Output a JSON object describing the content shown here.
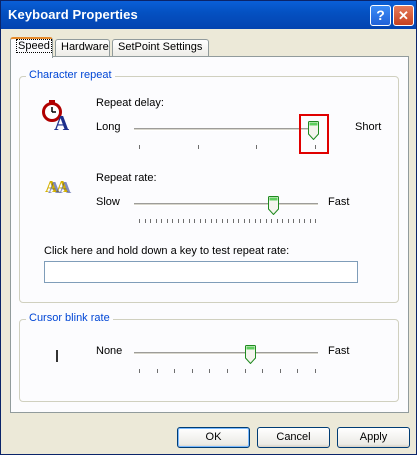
{
  "window": {
    "title": "Keyboard Properties"
  },
  "titlebar": {
    "help_label": "?",
    "close_label": "✕"
  },
  "tabs": [
    {
      "label": "Speed",
      "active": true
    },
    {
      "label": "Hardware",
      "active": false
    },
    {
      "label": "SetPoint Settings",
      "active": false
    }
  ],
  "character_repeat": {
    "group_title": "Character repeat",
    "repeat_delay": {
      "label": "Repeat delay:",
      "min_label": "Long",
      "max_label": "Short",
      "value": 4,
      "max": 4
    },
    "repeat_rate": {
      "label": "Repeat rate:",
      "min_label": "Slow",
      "max_label": "Fast",
      "value": 27,
      "max": 32
    },
    "test_label": "Click here and hold down a key to test repeat rate:",
    "test_value": ""
  },
  "cursor_blink": {
    "group_title": "Cursor blink rate",
    "min_label": "None",
    "max_label": "Fast",
    "value": 0.58
  },
  "buttons": {
    "ok": "OK",
    "cancel": "Cancel",
    "apply": "Apply"
  },
  "colors": {
    "titlebar": "#0451c2",
    "group_title": "#0046d5",
    "highlight": "#e00000",
    "thumb": "#21a121"
  }
}
